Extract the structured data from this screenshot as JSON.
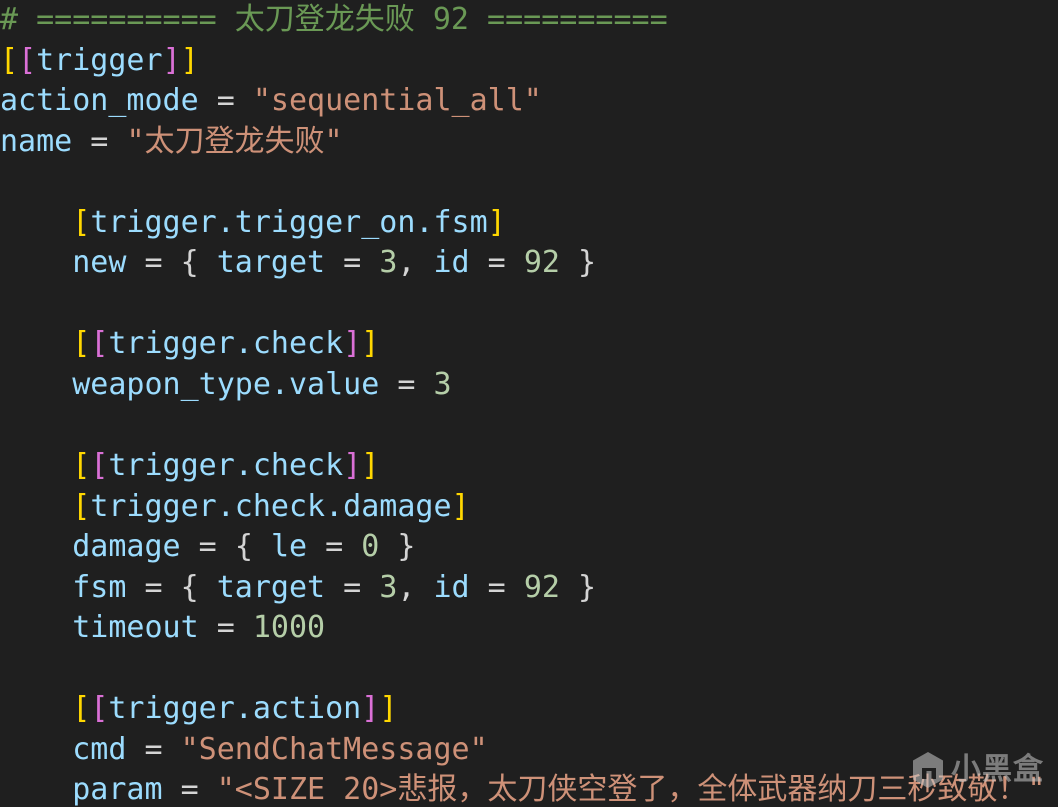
{
  "editor": {
    "background_color": "#1f1f1f",
    "language": "toml",
    "font_size_px": 30,
    "line_height_px": 40.55,
    "theme_colors": {
      "comment": "#6a9955",
      "bracket_outer": "#ffd700",
      "bracket_inner": "#da70d6",
      "table_name": "#9cdcfe",
      "key": "#9cdcfe",
      "string": "#ce9178",
      "number": "#b5cea8",
      "operator": "#d4d4d4"
    }
  },
  "code": {
    "line1": {
      "comment": "# ========== 太刀登龙失败 92 =========="
    },
    "line2": {
      "ob1": "[",
      "ob2": "[",
      "table": "trigger",
      "cb2": "]",
      "cb1": "]"
    },
    "line3": {
      "key": "action_mode",
      "eq": " = ",
      "value": "\"sequential_all\""
    },
    "line4": {
      "key": "name",
      "eq": " = ",
      "value": "\"太刀登龙失败\""
    },
    "line5": {
      "blank": " "
    },
    "line6": {
      "indent": "    ",
      "ob1": "[",
      "table": "trigger.trigger_on.fsm",
      "cb1": "]"
    },
    "line7": {
      "indent": "    ",
      "key": "new",
      "eq": " = ",
      "brace_open": "{ ",
      "k1": "target",
      "eq1": " = ",
      "v1": "3",
      "comma": ", ",
      "k2": "id",
      "eq2": " = ",
      "v2": "92",
      "brace_close": " }"
    },
    "line8": {
      "blank": " "
    },
    "line9": {
      "indent": "    ",
      "ob1": "[",
      "ob2": "[",
      "table": "trigger.check",
      "cb2": "]",
      "cb1": "]"
    },
    "line10": {
      "indent": "    ",
      "key": "weapon_type.value",
      "eq": " = ",
      "value": "3"
    },
    "line11": {
      "blank": " "
    },
    "line12": {
      "indent": "    ",
      "ob1": "[",
      "ob2": "[",
      "table": "trigger.check",
      "cb2": "]",
      "cb1": "]"
    },
    "line13": {
      "indent": "    ",
      "ob1": "[",
      "table": "trigger.check.damage",
      "cb1": "]"
    },
    "line14": {
      "indent": "    ",
      "key": "damage",
      "eq": " = ",
      "brace_open": "{ ",
      "k1": "le",
      "eq1": " = ",
      "v1": "0",
      "brace_close": " }"
    },
    "line15": {
      "indent": "    ",
      "key": "fsm",
      "eq": " = ",
      "brace_open": "{ ",
      "k1": "target",
      "eq1": " = ",
      "v1": "3",
      "comma": ", ",
      "k2": "id",
      "eq2": " = ",
      "v2": "92",
      "brace_close": " }"
    },
    "line16": {
      "indent": "    ",
      "key": "timeout",
      "eq": " = ",
      "value": "1000"
    },
    "line17": {
      "blank": " "
    },
    "line18": {
      "indent": "    ",
      "ob1": "[",
      "ob2": "[",
      "table": "trigger.action",
      "cb2": "]",
      "cb1": "]"
    },
    "line19": {
      "indent": "    ",
      "key": "cmd",
      "eq": " = ",
      "value": "\"SendChatMessage\""
    },
    "line20": {
      "indent": "    ",
      "key": "param",
      "eq": " = ",
      "value": "\"<SIZE 20>悲报，太刀侠空登了，全体武器纳刀三秒致敬！\""
    }
  },
  "watermark": {
    "text": "小黑盒",
    "logo_icon": "hexagon-h-icon",
    "color": "#c9c9c9"
  }
}
